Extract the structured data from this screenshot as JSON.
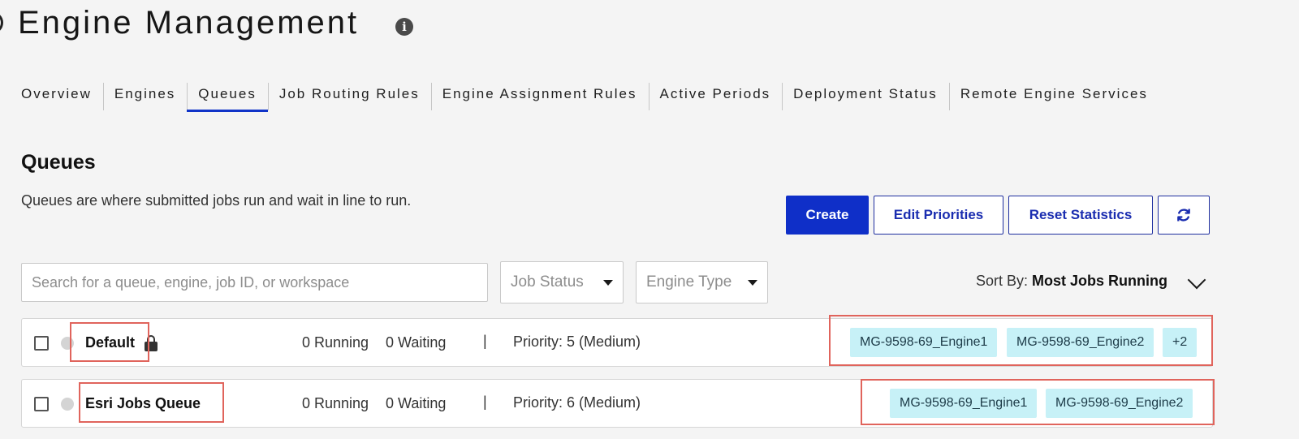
{
  "header": {
    "title": "Engine Management",
    "info_icon": "info-icon"
  },
  "tabs": [
    {
      "label": "Overview",
      "active": false
    },
    {
      "label": "Engines",
      "active": false
    },
    {
      "label": "Queues",
      "active": true
    },
    {
      "label": "Job Routing Rules",
      "active": false
    },
    {
      "label": "Engine Assignment Rules",
      "active": false
    },
    {
      "label": "Active Periods",
      "active": false
    },
    {
      "label": "Deployment Status",
      "active": false
    },
    {
      "label": "Remote Engine Services",
      "active": false
    }
  ],
  "section": {
    "title": "Queues",
    "description": "Queues are where submitted jobs run and wait in line to run."
  },
  "toolbar": {
    "create_label": "Create",
    "edit_priorities_label": "Edit Priorities",
    "reset_statistics_label": "Reset Statistics",
    "refresh_icon": "refresh-icon"
  },
  "filters": {
    "search_placeholder": "Search for a queue, engine, job ID, or workspace",
    "job_status_label": "Job Status",
    "engine_type_label": "Engine Type",
    "sort_prefix": "Sort By:",
    "sort_value": "Most Jobs Running"
  },
  "queues": [
    {
      "name": "Default",
      "running": "0 Running",
      "waiting": "0 Waiting",
      "separator": "|",
      "priority": "Priority: 5 (Medium)",
      "engines": [
        "MG-9598-69_Engine1",
        "MG-9598-69_Engine2",
        "+2"
      ]
    },
    {
      "name": "Esri Jobs Queue",
      "running": "0 Running",
      "waiting": "0 Waiting",
      "separator": "|",
      "priority": "Priority: 6 (Medium)",
      "engines": [
        "MG-9598-69_Engine1",
        "MG-9598-69_Engine2"
      ]
    }
  ],
  "colors": {
    "accent": "#0f2fc8",
    "tag_bg": "#c7f1f7",
    "highlight": "#e0645c"
  }
}
